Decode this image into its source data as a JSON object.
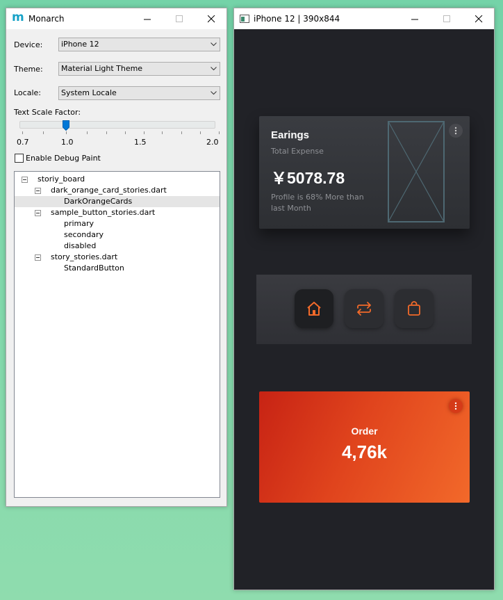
{
  "monarch": {
    "title": "Monarch",
    "logo_letter": "m",
    "device_label": "Device:",
    "device_value": "iPhone 12",
    "theme_label": "Theme:",
    "theme_value": "Material Light Theme",
    "locale_label": "Locale:",
    "locale_value": "System Locale",
    "text_scale_label": "Text Scale Factor:",
    "text_scale_value": 1.0,
    "slider_tick_labels": [
      "0.7",
      "1.0",
      "1.5",
      "2.0"
    ],
    "debug_paint_label": "Enable Debug Paint",
    "debug_paint_checked": false,
    "tree": [
      {
        "label": "storiy_board",
        "level": 0,
        "expandable": true
      },
      {
        "label": "dark_orange_card_stories.dart",
        "level": 1,
        "expandable": true
      },
      {
        "label": "DarkOrangeCards",
        "level": 2,
        "expandable": false,
        "selected": true
      },
      {
        "label": "sample_button_stories.dart",
        "level": 1,
        "expandable": true
      },
      {
        "label": "primary",
        "level": 2,
        "expandable": false
      },
      {
        "label": "secondary",
        "level": 2,
        "expandable": false
      },
      {
        "label": "disabled",
        "level": 2,
        "expandable": false
      },
      {
        "label": "story_stories.dart",
        "level": 1,
        "expandable": true
      },
      {
        "label": "StandardButton",
        "level": 2,
        "expandable": false
      }
    ]
  },
  "phone": {
    "title": "iPhone 12 | 390x844",
    "earnings_card": {
      "title": "Earings",
      "subtitle": "Total Expense",
      "amount": "￥5078.78",
      "note": "Profile is 68% More than last Month"
    },
    "nav_icons": [
      "home-icon",
      "repeat-icon",
      "shopping-bag-icon"
    ],
    "order_card": {
      "label": "Order",
      "value": "4,76k"
    },
    "colors": {
      "background": "#212227",
      "card": "#35373c",
      "accent": "#f26a2a",
      "order_gradient_start": "#c72314",
      "order_gradient_end": "#f2692a"
    }
  }
}
